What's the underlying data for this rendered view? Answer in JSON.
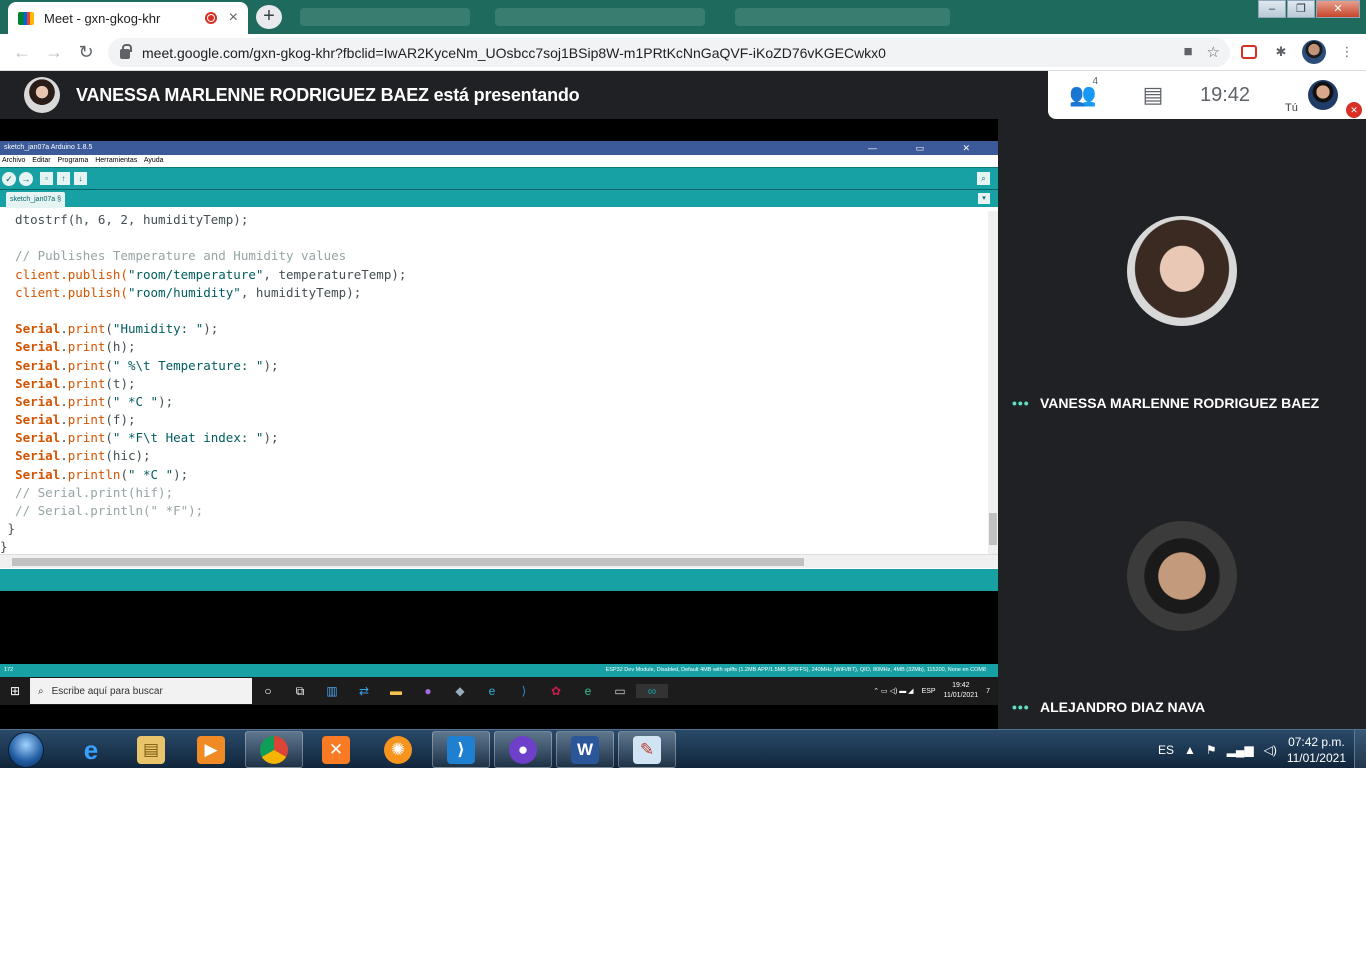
{
  "browser": {
    "tab_title": "Meet - gxn-gkog-khr",
    "url": "meet.google.com/gxn-gkog-khr?fbclid=IwAR2KyceNm_UOsbcc7soj1BSip8W-m1PRtKcNnGaQVF-iKoZD76vKGECwkx0",
    "new_tab_label": "+",
    "close_label": "×"
  },
  "meet": {
    "presenting_text": "VANESSA MARLENNE RODRIGUEZ BAEZ está presentando",
    "participant_count": "4",
    "clock": "19:42",
    "you_label": "Tú",
    "participants": [
      {
        "name": "VANESSA MARLENNE RODRIGUEZ BAEZ",
        "dots": "•••"
      },
      {
        "name": "ALEJANDRO DIAZ NAVA",
        "dots": "•••"
      }
    ]
  },
  "arduino": {
    "window_title": "sketch_jan07a Arduino 1.8.5",
    "window_buttons": "—  ▭  ✕",
    "menu": [
      "Archivo",
      "Editar",
      "Programa",
      "Herramientas",
      "Ayuda"
    ],
    "tab_label": "sketch_jan07a §",
    "line_indicator": "172",
    "board_status": "ESP32 Dev Module, Disabled, Default 4MB with spiffs (1.2MB APP/1.5MB SPIFFS), 240MHz (WiFi/BT), QIO, 80MHz, 4MB (32Mb), 115200, None en COM8",
    "code": {
      "l1": "  dtostrf(h, 6, 2, humidityTemp);",
      "l3": "  // Publishes Temperature and Humidity values",
      "l4a": "client.publish(",
      "l4s": "\"room/temperature\"",
      "l4b": ", temperatureTemp);",
      "l5a": "client.publish(",
      "l5s": "\"room/humidity\"",
      "l5b": ", humidityTemp);",
      "serial": "Serial",
      "print": "print",
      "println": "println",
      "l7s": "\"Humidity: \"",
      "l8": "(h);",
      "l9s": "\" %\\t Temperature: \"",
      "l10": "(t);",
      "l11s": "\" *C \"",
      "l12": "(f);",
      "l13s": "\" *F\\t Heat index: \"",
      "l14": "(hic);",
      "l15s": "\" *C \"",
      "l16": "  // Serial.print(hif);",
      "l17": "  // Serial.println(\" *F\");",
      "l18": " }",
      "l19": "}"
    }
  },
  "inner_taskbar": {
    "search_placeholder": "Escribe aquí para buscar",
    "lang": "ESP",
    "time": "19:42",
    "date": "11/01/2021",
    "notif_count": "7"
  },
  "win7_taskbar": {
    "lang": "ES",
    "time": "07:42 p.m.",
    "date": "11/01/2021"
  }
}
